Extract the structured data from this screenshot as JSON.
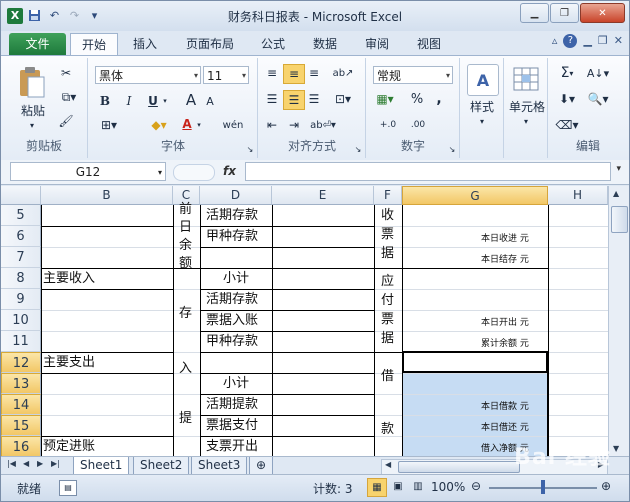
{
  "window": {
    "title": "财务科日报表 - Microsoft Excel"
  },
  "qat": {
    "logo": "X",
    "undo": "↶",
    "redo": "↷"
  },
  "tabs": [
    "文件",
    "开始",
    "插入",
    "页面布局",
    "公式",
    "数据",
    "审阅",
    "视图"
  ],
  "ribbon": {
    "paste_label": "粘贴",
    "font_name": "黑体",
    "font_size": "11",
    "bold": "B",
    "italic": "I",
    "underline": "U",
    "grow_font": "A",
    "shrink_font": "A",
    "font_color_letter": "A",
    "wen_glyph": "wén",
    "number_format": "常规",
    "percent": "%",
    "comma": ",",
    "dec_inc": "+.0",
    "dec_dec": ".00",
    "style_label": "样式",
    "cells_label": "单元格",
    "sigma": "Σ",
    "groups": {
      "clipboard": "剪贴板",
      "font": "字体",
      "align": "对齐方式",
      "number": "数字",
      "edit": "编辑"
    }
  },
  "formula_bar": {
    "name_box": "G12",
    "fx": "fx",
    "value": ""
  },
  "columns": [
    "B",
    "C",
    "D",
    "E",
    "F",
    "G",
    "H"
  ],
  "rows": [
    "5",
    "6",
    "7",
    "8",
    "9",
    "10",
    "11",
    "12",
    "13",
    "14",
    "15",
    "16"
  ],
  "cells": {
    "b8": "主要收入",
    "b12": "主要支出",
    "b16": "预定进账",
    "c_qian": "前",
    "c_ri": "日",
    "c_yu": "余",
    "c_e": "额",
    "c_cun": "存",
    "c_ru": "入",
    "c_ti": "提",
    "d5": "活期存款",
    "d6": "甲种存款",
    "d8": "小计",
    "d9": "活期存款",
    "d10": "票据入账",
    "d11": "甲种存款",
    "d13": "小计",
    "d14": "活期提款",
    "d15": "票据支付",
    "d16": "支票开出",
    "f_shou": "收",
    "f_piao1": "票",
    "f_ju1": "据",
    "f_ying": "应",
    "f_fu": "付",
    "f_piao2": "票",
    "f_ju2": "据",
    "f_jie": "借",
    "f_kuan": "款",
    "g6": "本日收进  元",
    "g7": "本日结存  元",
    "g10": "本日开出  元",
    "g11": "累计余额  元",
    "g14": "本日借款  元",
    "g15": "本日借还  元",
    "g16": "借入净额  元"
  },
  "sheets": [
    "Sheet1",
    "Sheet2",
    "Sheet3"
  ],
  "active_sheet": "Sheet1",
  "status": {
    "ready": "就绪",
    "count": "计数: 3",
    "zoom": "100%"
  },
  "watermark": "Bai 经验"
}
